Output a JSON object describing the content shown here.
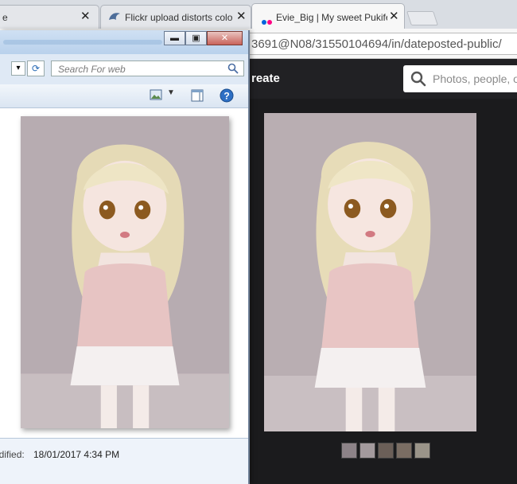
{
  "browser": {
    "tabs": [
      {
        "label": "e",
        "close": "✕"
      },
      {
        "label": "Flickr upload distorts colo",
        "close": "✕"
      },
      {
        "label": "Evie_Big | My sweet Pukifee",
        "close": "✕"
      }
    ],
    "url": "3691@N08/31550104694/in/dateposted-public/"
  },
  "flickr": {
    "header_link": "reate",
    "search_placeholder": "Photos, people, or",
    "thumbnail_count": 5
  },
  "photo_viewer": {
    "window_buttons": {
      "minimize": "▬",
      "maximize": "▣",
      "close": "✕"
    },
    "search_placeholder": "Search For web",
    "status_key": "odified:",
    "status_value": "18/01/2017 4:34 PM"
  },
  "colors": {
    "flickr_blue": "#0063dc",
    "flickr_pink": "#ff0084",
    "flickr_dark": "#212124",
    "photo_background": "#b9aeb2"
  },
  "icons": [
    "flickr-logo-icon",
    "google-chrome-icon",
    "search-icon",
    "refresh-icon",
    "picture-icon",
    "window-pane-icon",
    "help-icon"
  ]
}
